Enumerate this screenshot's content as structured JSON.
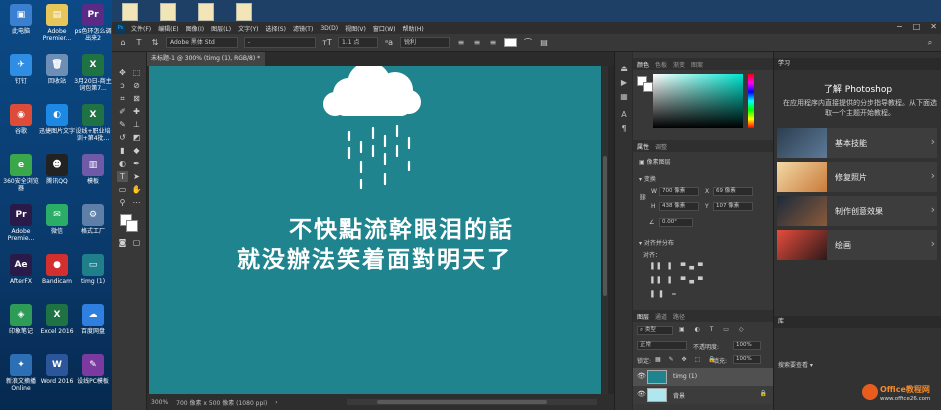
{
  "desktop": {
    "icons": [
      {
        "label": "此电脑",
        "glyph": "▣",
        "color": "#3b7fd0"
      },
      {
        "label": "Adobe Premier...",
        "glyph": "▤",
        "color": "#e7c65a"
      },
      {
        "label": "ps色环怎么调出来2",
        "glyph": "Pr",
        "color": "#5b2a86"
      },
      {
        "label": "钉钉",
        "glyph": "✈",
        "color": "#2f8de4"
      },
      {
        "label": "回收站",
        "glyph": "🗑",
        "color": "#6d8fb5"
      },
      {
        "label": "3月20日-商主词包第7...",
        "glyph": "X",
        "color": "#1f7244"
      },
      {
        "label": "谷歌",
        "glyph": "◉",
        "color": "#dd4b39"
      },
      {
        "label": "迅捷图片文字",
        "glyph": "◐",
        "color": "#1e88e5"
      },
      {
        "label": "设线+职业培训+第4批...",
        "glyph": "X",
        "color": "#1f7244"
      },
      {
        "label": "360安全浏览器",
        "glyph": "e",
        "color": "#3aa84a"
      },
      {
        "label": "腾讯QQ",
        "glyph": "☻",
        "color": "#222"
      },
      {
        "label": "模板",
        "glyph": "▥",
        "color": "#6f5aa8"
      },
      {
        "label": "Adobe Premie...",
        "glyph": "Pr",
        "color": "#2a1a4a"
      },
      {
        "label": "微信",
        "glyph": "✉",
        "color": "#2aae67"
      },
      {
        "label": "格式工厂",
        "glyph": "⚙",
        "color": "#5d7fa8"
      },
      {
        "label": "AfterFX",
        "glyph": "Ae",
        "color": "#2a1a4a"
      },
      {
        "label": "Bandicam",
        "glyph": "●",
        "color": "#d32f2f"
      },
      {
        "label": "timg (1)",
        "glyph": "▭",
        "color": "#1f7f8a"
      },
      {
        "label": "印象笔记",
        "glyph": "◈",
        "color": "#2e9b57"
      },
      {
        "label": "Excel 2016",
        "glyph": "X",
        "color": "#1f7244"
      },
      {
        "label": "百度网盘",
        "glyph": "☁",
        "color": "#2f7fe0"
      },
      {
        "label": "新浪文摘播 Online",
        "glyph": "✦",
        "color": "#2d6fb5"
      },
      {
        "label": "Word 2016",
        "glyph": "W",
        "color": "#2b579a"
      },
      {
        "label": "设线PC模板",
        "glyph": "✎",
        "color": "#7a3aa0"
      }
    ]
  },
  "menu": {
    "items": [
      "文件(F)",
      "编辑(E)",
      "图像(I)",
      "图层(L)",
      "文字(Y)",
      "选择(S)",
      "滤镜(T)",
      "3D(D)",
      "视图(V)",
      "窗口(W)",
      "帮助(H)"
    ]
  },
  "options": {
    "font_family": "Adobe 黑体 Std",
    "font_style": "-",
    "font_size": "1.1 点",
    "aa_mode": "锐利",
    "ps_logo": "Ps"
  },
  "document": {
    "tab_title": "未标题-1 @ 300% (timg (1), RGB/8) *",
    "caption_line1": "不快點流幹眼泪的話",
    "caption_line2": "就没辦法笑着面對明天了",
    "canvas_color": "#20848e"
  },
  "status": {
    "zoom": "300%",
    "doc_size": "700 像素 x 500 像素 (1080 ppi)"
  },
  "color_panel": {
    "tabs": [
      "颜色",
      "色板",
      "渐变",
      "图案"
    ]
  },
  "properties_panel": {
    "tabs": [
      "属性",
      "调整"
    ],
    "type_label": "像素图层",
    "transform_label": "变换",
    "w": "700 像素",
    "h": "438 像素",
    "x": "69 像素",
    "y": "107 像素",
    "angle": "0.00°",
    "align_label": "对齐并分布",
    "align_sub": "对齐："
  },
  "layers_panel": {
    "tabs": [
      "图层",
      "通道",
      "路径"
    ],
    "kind": "类型",
    "blend_mode": "正常",
    "opacity_label": "不透明度:",
    "opacity": "100%",
    "lock_label": "锁定:",
    "fill_label": "填充:",
    "fill": "100%",
    "layers": [
      {
        "name": "timg (1)",
        "selected": true
      },
      {
        "name": "背景",
        "selected": false
      }
    ]
  },
  "learn_panel": {
    "tab": "学习",
    "title": "了解 Photoshop",
    "description": "在应用程序内直接提供的分步指导教程。从下面选取一个主题开始教程。",
    "cards": [
      {
        "label": "基本技能",
        "color": "#3b4a5a"
      },
      {
        "label": "修复照片",
        "color": "#c98a4a"
      },
      {
        "label": "制作创意效果",
        "color": "#6a4a3a"
      },
      {
        "label": "绘画",
        "color": "#c0392b"
      }
    ],
    "lib_tab": "库",
    "lib_search": "搜索要查看"
  },
  "watermark": {
    "text": "Office教程网",
    "url": "www.office26.com"
  }
}
